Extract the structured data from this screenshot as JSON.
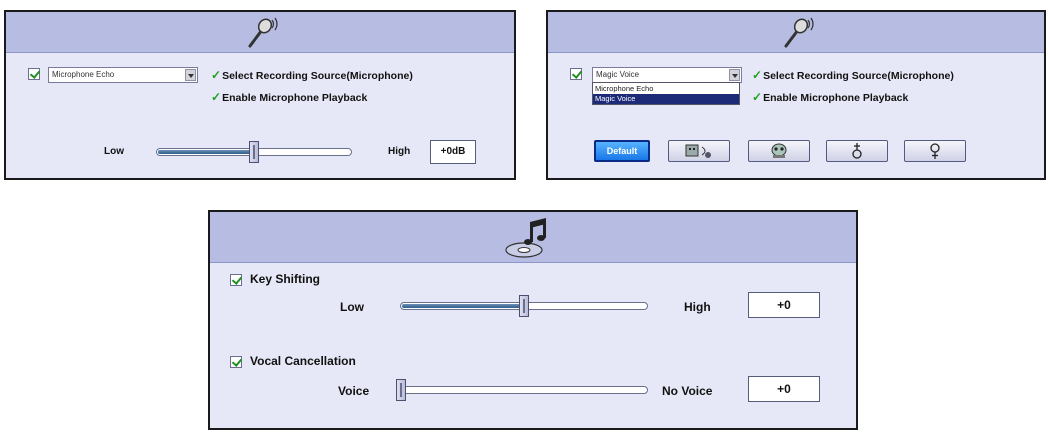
{
  "panel1": {
    "effect_select": "Microphone Echo",
    "option1": "Select Recording Source(Microphone)",
    "option2": "Enable Microphone Playback",
    "low_label": "Low",
    "high_label": "High",
    "level_value": "+0dB",
    "slider_fraction": 0.5
  },
  "panel2": {
    "effect_select": "Magic Voice",
    "dropdown_options": [
      "Microphone Echo",
      "Magic Voice"
    ],
    "option1": "Select Recording Source(Microphone)",
    "option2": "Enable Microphone Playback",
    "default_button": "Default",
    "voice_buttons": [
      "robot-voice-icon",
      "alien-voice-icon",
      "male-voice-icon",
      "female-voice-icon"
    ]
  },
  "panel3": {
    "key_shifting_label": "Key Shifting",
    "key_low": "Low",
    "key_high": "High",
    "key_value": "+0",
    "key_fraction": 0.5,
    "vocal_label": "Vocal Cancellation",
    "vocal_low": "Voice",
    "vocal_high": "No Voice",
    "vocal_value": "+0",
    "vocal_fraction": 0.0
  },
  "colors": {
    "panel_bg": "#e7e8f7",
    "header_bg": "#b6bce2",
    "accent_blue": "#1878e8",
    "check_green": "#21a021"
  }
}
